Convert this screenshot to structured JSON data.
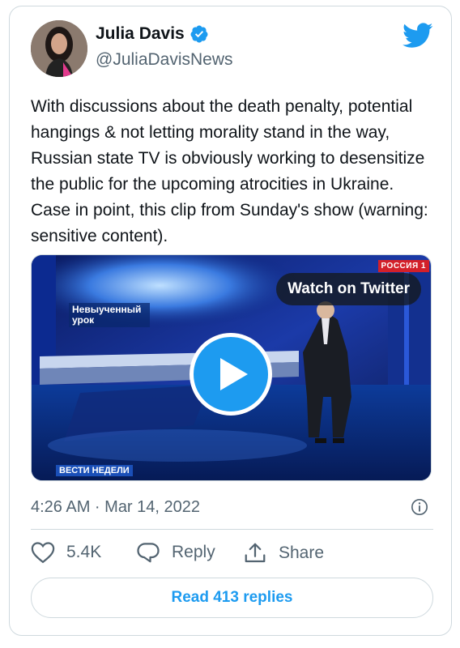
{
  "author": {
    "name": "Julia Davis",
    "handle": "@JuliaDavisNews",
    "verified": true
  },
  "tweet": {
    "text": "With discussions about the death penalty, potential hangings & not letting morality stand in the way, Russian state TV is obviously working to desensitize the public for the upcoming atrocities in Ukraine. Case in point, this clip from Sunday's show (warning: sensitive content)."
  },
  "media": {
    "watch_label": "Watch on Twitter",
    "tv_title": "Невыученный урок",
    "channel_badge": "РОССИЯ 1",
    "show_badge": "ВЕСТИ НЕДЕЛИ"
  },
  "meta": {
    "timestamp": "4:26 AM · Mar 14, 2022"
  },
  "actions": {
    "likes": "5.4K",
    "reply_label": "Reply",
    "share_label": "Share"
  },
  "footer": {
    "read_replies": "Read 413 replies"
  },
  "colors": {
    "accent": "#1d9bf0",
    "secondary_text": "#536471",
    "border": "#cfd9de"
  },
  "icons": [
    "verified-badge-icon",
    "twitter-bird-icon",
    "play-icon",
    "info-icon",
    "heart-icon",
    "reply-icon",
    "share-icon"
  ]
}
